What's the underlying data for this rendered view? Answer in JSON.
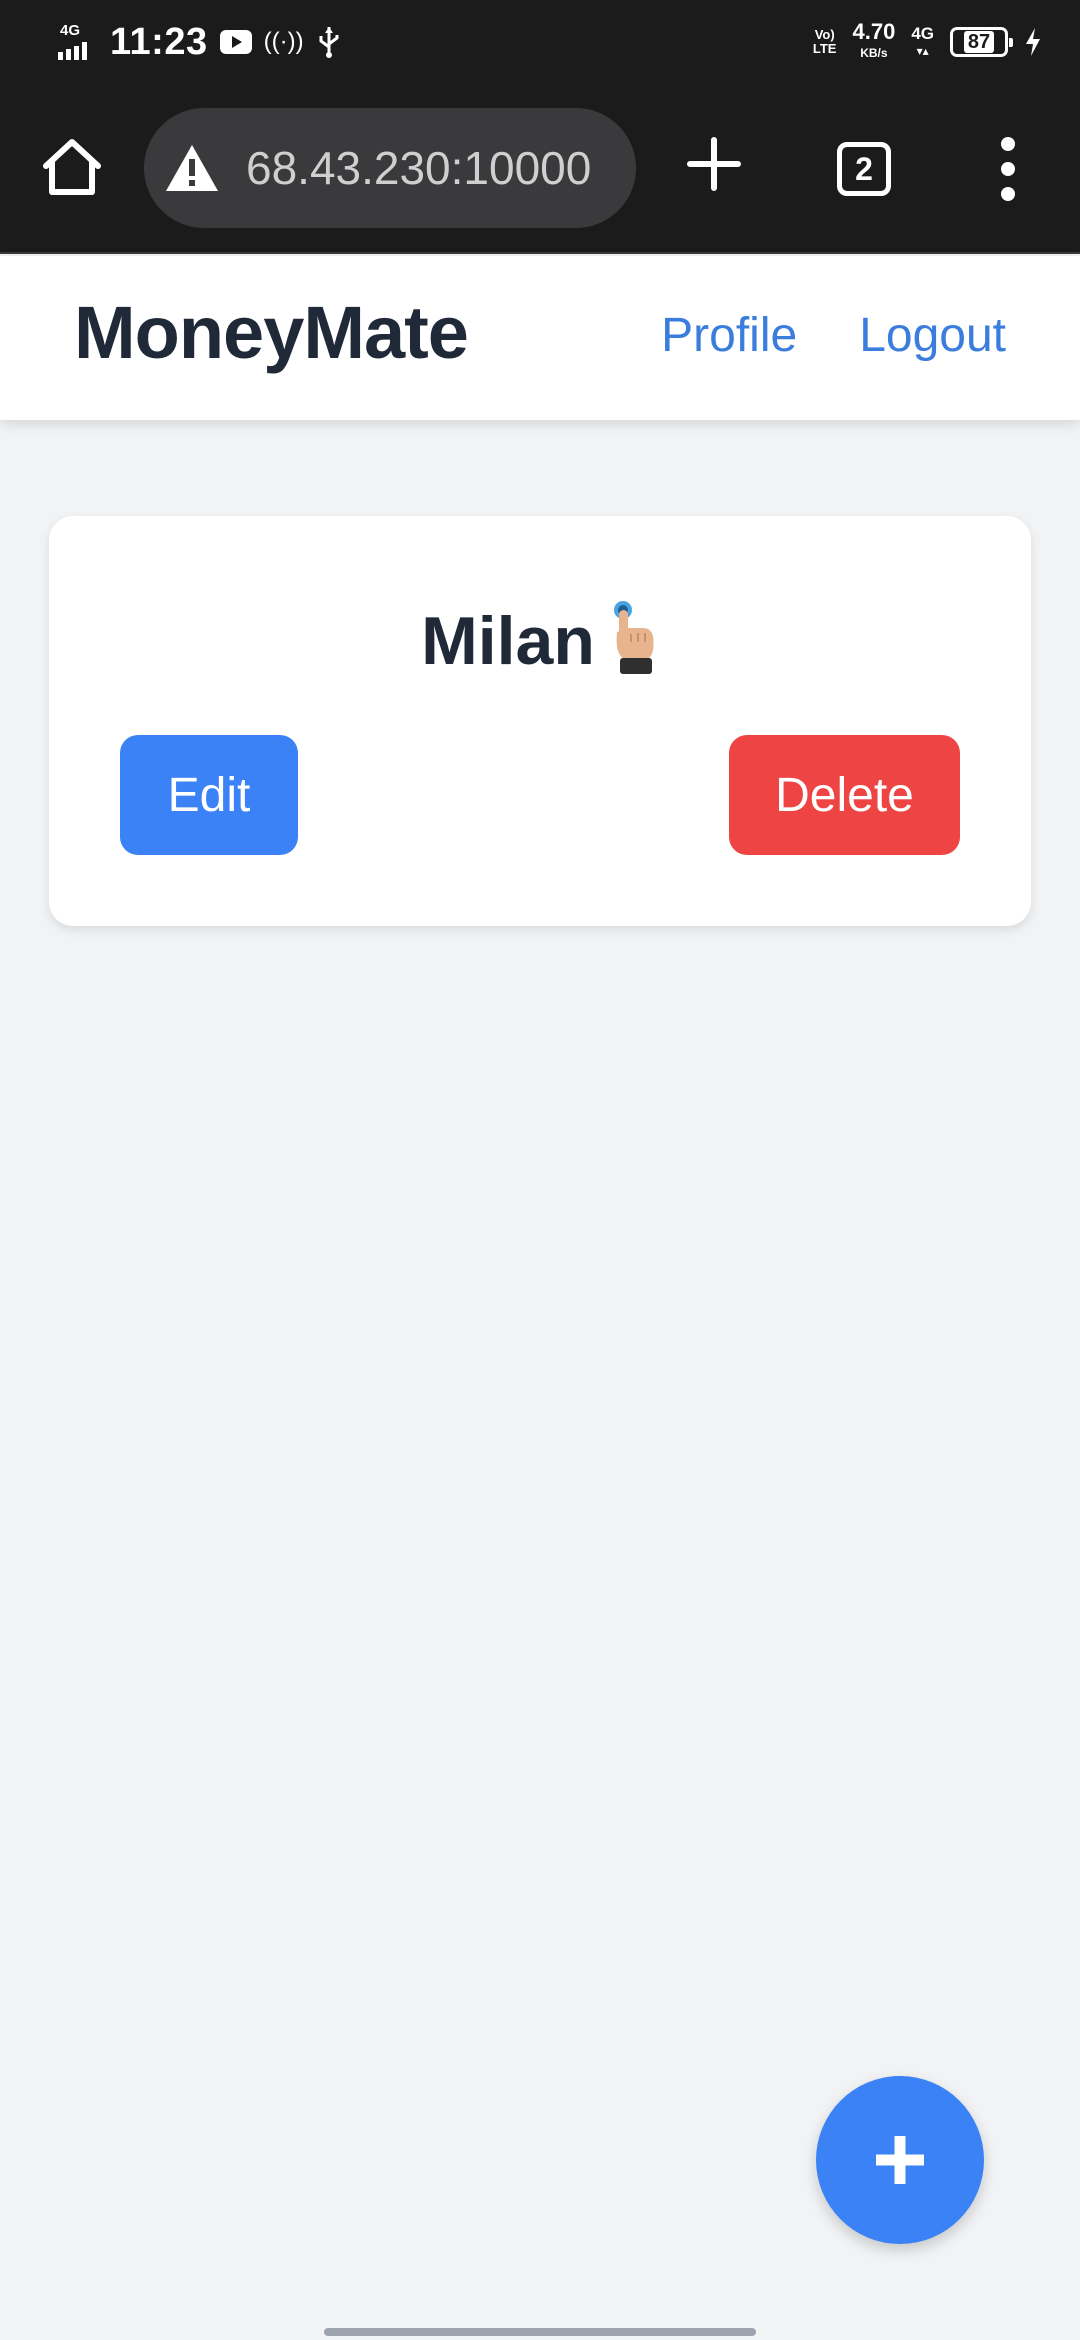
{
  "status_bar": {
    "network_label": "4G",
    "time": "11:23",
    "volte_label_top": "Vo)",
    "volte_label_bottom": "LTE",
    "speed_value": "4.70",
    "speed_unit": "KB/s",
    "mobile_data_label": "4G",
    "battery_level": "87",
    "icons": [
      "signal-icon",
      "youtube-icon",
      "hotspot-icon",
      "usb-icon",
      "data-arrows-icon",
      "battery-icon",
      "charging-bolt-icon"
    ]
  },
  "browser": {
    "url": "68.43.230:10000",
    "tab_count": "2",
    "icons": [
      "home-icon",
      "warning-icon",
      "plus-icon",
      "tabs-icon",
      "more-vert-icon"
    ],
    "colors": {
      "bar": "#1b1b1b",
      "url_pill": "#3a3a3c"
    }
  },
  "header": {
    "brand": "MoneyMate",
    "nav": {
      "profile": "Profile",
      "logout": "Logout"
    }
  },
  "card": {
    "title": "Milan",
    "edit_label": "Edit",
    "delete_label": "Delete"
  },
  "fab": {
    "icon": "plus-icon",
    "label": "+"
  },
  "colors": {
    "primary": "#3b82f6",
    "danger": "#ef4444",
    "link": "#3b7ddd",
    "text_dark": "#1f2937",
    "page_bg": "#f1f3f5"
  }
}
